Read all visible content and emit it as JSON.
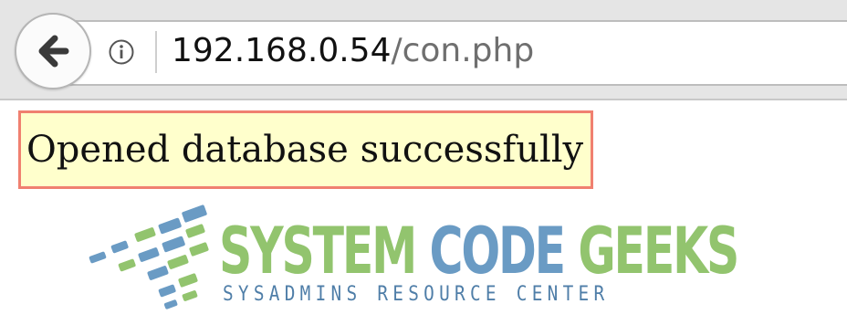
{
  "browser": {
    "url_host": "192.168.0.54",
    "url_path": "/con.php",
    "back_icon": "arrow-left-icon",
    "info_icon": "info-icon"
  },
  "page": {
    "message": "Opened database successfully",
    "message_bg": "#ffffcc",
    "message_border": "#f08070"
  },
  "logo": {
    "title_word1": "SYSTEM",
    "title_word2": "CODE",
    "title_word3": "GEEKS",
    "subtitle": "SYSADMINS RESOURCE CENTER",
    "green": "#92c46e",
    "blue": "#6a9bc4"
  }
}
